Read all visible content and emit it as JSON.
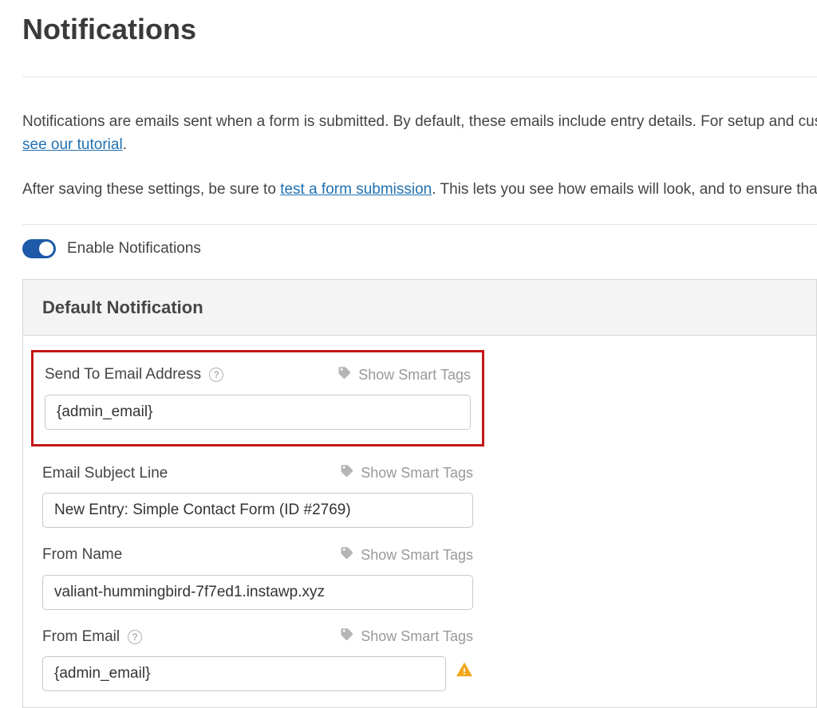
{
  "page": {
    "title": "Notifications"
  },
  "intro": {
    "line1_a": "Notifications are emails sent when a form is submitted. By default, these emails include entry details. For setup and cus",
    "line1_link": "see our tutorial",
    "line1_b": ".",
    "line2_a": "After saving these settings, be sure to ",
    "line2_link": "test a form submission",
    "line2_b": ". This lets you see how emails will look, and to ensure that"
  },
  "enable": {
    "label": "Enable Notifications"
  },
  "panel": {
    "title": "Default Notification",
    "smart_tags": "Show Smart Tags",
    "fields": {
      "send_to": {
        "label": "Send To Email Address",
        "value": "{admin_email}"
      },
      "subject": {
        "label": "Email Subject Line",
        "value": "New Entry: Simple Contact Form (ID #2769)"
      },
      "from_name": {
        "label": "From Name",
        "value": "valiant-hummingbird-7f7ed1.instawp.xyz"
      },
      "from_email": {
        "label": "From Email",
        "value": "{admin_email}"
      }
    }
  }
}
